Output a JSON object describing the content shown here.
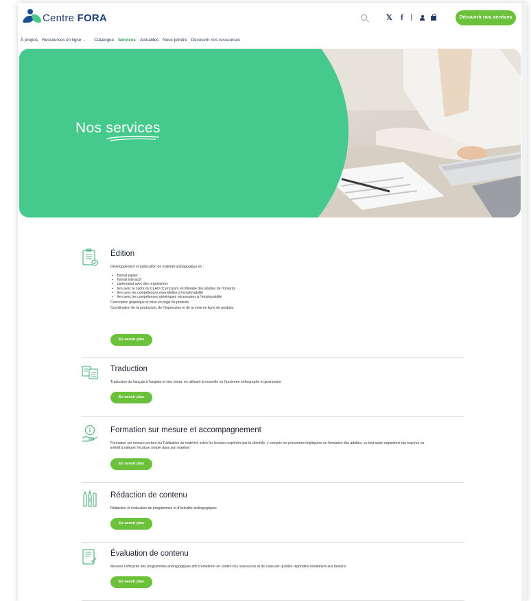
{
  "header": {
    "logo_text_a": "Centre ",
    "logo_text_b": "FORA",
    "social_x": "𝕏",
    "social_fb": "f",
    "separator": "|",
    "cta_label": "Découvrir nos services"
  },
  "nav": {
    "items": [
      "À propos",
      "Ressources en ligne",
      "Catalogue",
      "Services",
      "Actualités",
      "Nous joindre",
      "Découvrir nos ressources"
    ],
    "active": "Services"
  },
  "hero": {
    "title_plain": "Nos ",
    "title_underlined": "services"
  },
  "colors": {
    "accent_green": "#46c98c",
    "button_green": "#6cc13a",
    "brand_blue": "#1c3f7a"
  },
  "services": [
    {
      "title": "Édition",
      "icon": "document-checklist-icon",
      "description": "Développement et publication de matériel andragogique en :",
      "list": [
        "format papier",
        "format interactif",
        "partenariat avec des organismes",
        "lien avec le cadre du CLAO (Curriculum en littératie des adultes de l'Ontario)",
        "lien avec les compétences essentielles à l'employabilité",
        "lien avec les compétences génériques nécessaires à l'employabilité"
      ],
      "extra": [
        "Conception graphique et mise en page de produits",
        "Coordination de la production, de l'impression et de la mise en ligne de produits"
      ],
      "button": "En savoir plus"
    },
    {
      "title": "Traduction",
      "icon": "translate-documents-icon",
      "description": "Traduction du français à l'anglais et vice versa, en utilisant la nouvelle ou l'ancienne orthographe et grammaire",
      "button": "En savoir plus"
    },
    {
      "title": "Formation sur mesure et accompagnement",
      "icon": "hand-info-icon",
      "description": "Formation sur mesure portant sur l'utilisation du matériel, selon les besoins exprimés par la clientèle, y compris les personnes impliquées en formation des adultes, ou tout autre organisme qui exprime un intérêt à intégrer l'écriture simple dans son matériel",
      "button": "En savoir plus"
    },
    {
      "title": "Rédaction de contenu",
      "icon": "pens-icon",
      "description": "Rédaction et évaluation de programmes et d'activités andragogiques",
      "button": "En savoir plus"
    },
    {
      "title": "Évaluation de contenu",
      "icon": "document-evaluation-icon",
      "description": "Mesurer l'efficacité des programmes andragogiques afin d'améliorer en continu les ressources et de s'assurer qu'elles répondent réellement aux besoins",
      "button": "En savoir plus"
    }
  ]
}
